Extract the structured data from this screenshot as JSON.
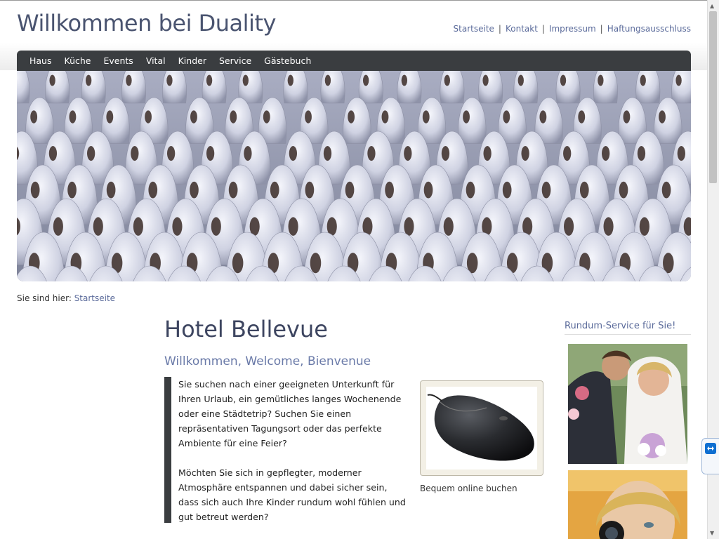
{
  "header": {
    "title": "Willkommen bei Duality",
    "top_links": [
      "Startseite",
      "Kontakt",
      "Impressum",
      "Haftungsausschluss"
    ],
    "separator": "|"
  },
  "nav": {
    "items": [
      "Haus",
      "Küche",
      "Events",
      "Vital",
      "Kinder",
      "Service",
      "Gästebuch"
    ]
  },
  "breadcrumb": {
    "prefix": "Sie sind hier:",
    "current": "Startseite"
  },
  "main": {
    "title": "Hotel Bellevue",
    "subtitle": "Willkommen, Welcome, Bienvenue",
    "paragraphs": [
      "Sie suchen nach einer geeigneten Unterkunft für Ihren Urlaub, ein gemütliches langes Wochenende oder eine Städtetrip? Suchen Sie einen repräsentativen Tagungsort oder das perfekte Ambiente für eine Feier?",
      "Möchten Sie sich in gepflegter, moderner Atmosphäre entspannen und dabei sicher sein, dass sich auch Ihre Kinder rundum wohl fühlen und gut betreut werden?"
    ],
    "teaser_caption": "Bequem online buchen"
  },
  "sidebar": {
    "title": "Rundum-Service für Sie!"
  },
  "colors": {
    "nav_bg": "#3a3d40",
    "link": "#5a6a9a",
    "title": "#4a5470"
  }
}
